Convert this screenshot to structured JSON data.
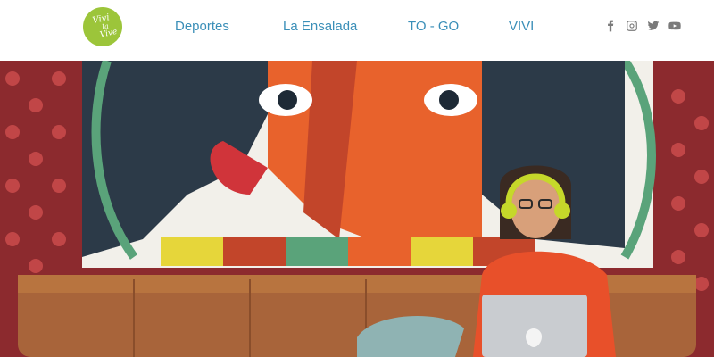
{
  "logo": {
    "line1": "Vivi",
    "line2": "la",
    "line3": "Vive"
  },
  "nav": {
    "items": [
      "Deportes",
      "La Ensalada",
      "TO - GO",
      "VIVI"
    ]
  },
  "social": {
    "icons": [
      "facebook-icon",
      "instagram-icon",
      "twitter-icon",
      "youtube-icon"
    ]
  },
  "colors": {
    "brand_green": "#9cc53a",
    "nav_text": "#3b8fb8",
    "icon_gray": "#7a7a7a"
  }
}
